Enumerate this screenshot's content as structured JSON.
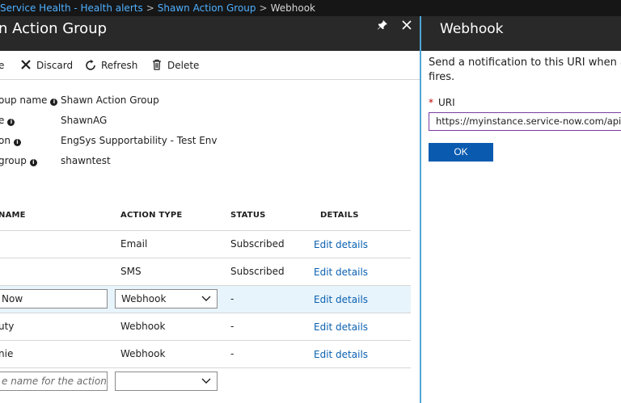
{
  "breadcrumb": {
    "items": [
      "Service Health - Health alerts",
      "Shawn Action Group"
    ],
    "current": "Webhook",
    "separator": ">"
  },
  "left_blade": {
    "title": "n Action Group",
    "pin_icon": "pin-icon",
    "close_icon": "close-icon"
  },
  "toolbar": {
    "save_label": "e",
    "discard_label": "Discard",
    "refresh_label": "Refresh",
    "delete_label": "Delete"
  },
  "properties": [
    {
      "label": "oup name",
      "value": "Shawn Action Group"
    },
    {
      "label": "e",
      "value": "ShawnAG"
    },
    {
      "label": "on",
      "value": "EngSys Supportability - Test Env"
    },
    {
      "label": "group",
      "value": "shawntest"
    }
  ],
  "actions_table": {
    "headers": {
      "name": "NAME",
      "action_type": "ACTION TYPE",
      "status": "STATUS",
      "details": "DETAILS"
    },
    "rows": [
      {
        "name": "",
        "action_type": "Email",
        "status": "Subscribed",
        "details": "Edit details"
      },
      {
        "name": "",
        "action_type": "SMS",
        "status": "Subscribed",
        "details": "Edit details"
      },
      {
        "name": "Now",
        "action_type": "Webhook",
        "status": "-",
        "details": "Edit details"
      },
      {
        "name": "uty",
        "action_type": "Webhook",
        "status": "-",
        "details": "Edit details"
      },
      {
        "name": "nie",
        "action_type": "Webhook",
        "status": "-",
        "details": "Edit details"
      }
    ],
    "new_row": {
      "name_placeholder": "e name for the action",
      "action_type": ""
    }
  },
  "webhook_blade": {
    "title": "Webhook",
    "description_line1": "Send a notification to this URI when an",
    "description_line2": "fires.",
    "uri_required_mark": "*",
    "uri_label": "URI",
    "uri_value": "https://myinstance.service-now.com/api/x",
    "ok_label": "OK"
  },
  "colors": {
    "header_bg": "#292929",
    "breadcrumb_bg": "#161616",
    "link": "#0a60b0",
    "accent_button": "#0a5bb0",
    "selected_row": "#e8f4fc"
  }
}
